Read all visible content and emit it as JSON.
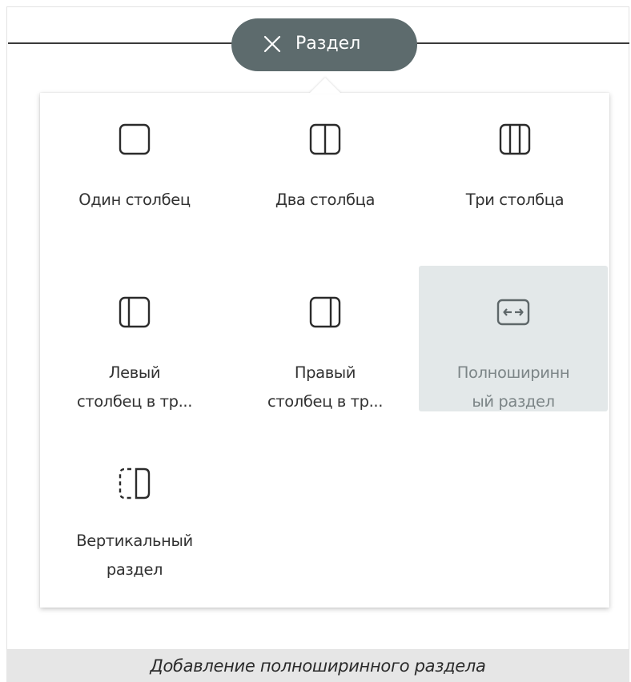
{
  "section_pill": {
    "label": "Раздел",
    "close_icon": "close-icon"
  },
  "layouts": [
    {
      "name": "one-column",
      "label": "Один столбец",
      "icon": "one-column-icon",
      "selected": false
    },
    {
      "name": "two-columns",
      "label": "Два столбца",
      "icon": "two-columns-icon",
      "selected": false
    },
    {
      "name": "three-columns",
      "label": "Три столбца",
      "icon": "three-columns-icon",
      "selected": false
    },
    {
      "name": "left-column-in-three",
      "label": "Левый\nстолбец в тр...",
      "icon": "left-column-icon",
      "selected": false
    },
    {
      "name": "right-column-in-three",
      "label": "Правый\nстолбец в тр...",
      "icon": "right-column-icon",
      "selected": false
    },
    {
      "name": "full-width-section",
      "label": "Полноширинн\nый раздел",
      "icon": "full-width-arrows-icon",
      "selected": true
    },
    {
      "name": "vertical-section",
      "label": "Вертикальный\nраздел",
      "icon": "vertical-section-icon",
      "selected": false
    }
  ],
  "caption": "Добавление полноширинного раздела",
  "colors": {
    "pill_background": "#5d6b6d",
    "selected_tile_background": "#e3e8e9",
    "icon_stroke": "#2b2b2b",
    "selected_text": "#7c8587",
    "caption_background": "#e6e6e6"
  }
}
